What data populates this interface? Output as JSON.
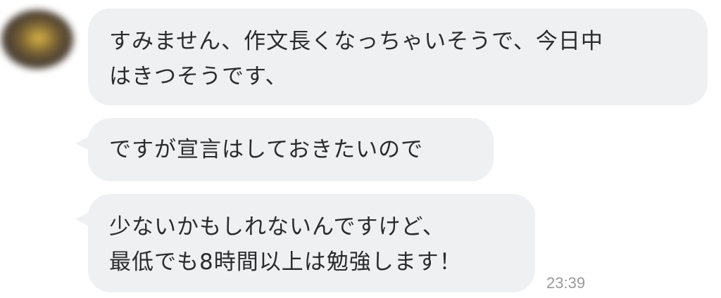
{
  "messages": [
    {
      "lines": [
        "すみません、作文長くなっちゃいそうで、今日中",
        "はきつそうです、"
      ]
    },
    {
      "lines": [
        "ですが宣言はしておきたいので"
      ]
    },
    {
      "lines": [
        "少ないかもしれないんですけど、",
        "最低でも8時間以上は勉強します！"
      ]
    }
  ],
  "timestamp": "23:39",
  "colors": {
    "bubble_background": "#eff0f2",
    "message_text": "#2b2b2b",
    "timestamp_text": "#9a9a9a"
  },
  "icons": {
    "avatar": "avatar"
  }
}
